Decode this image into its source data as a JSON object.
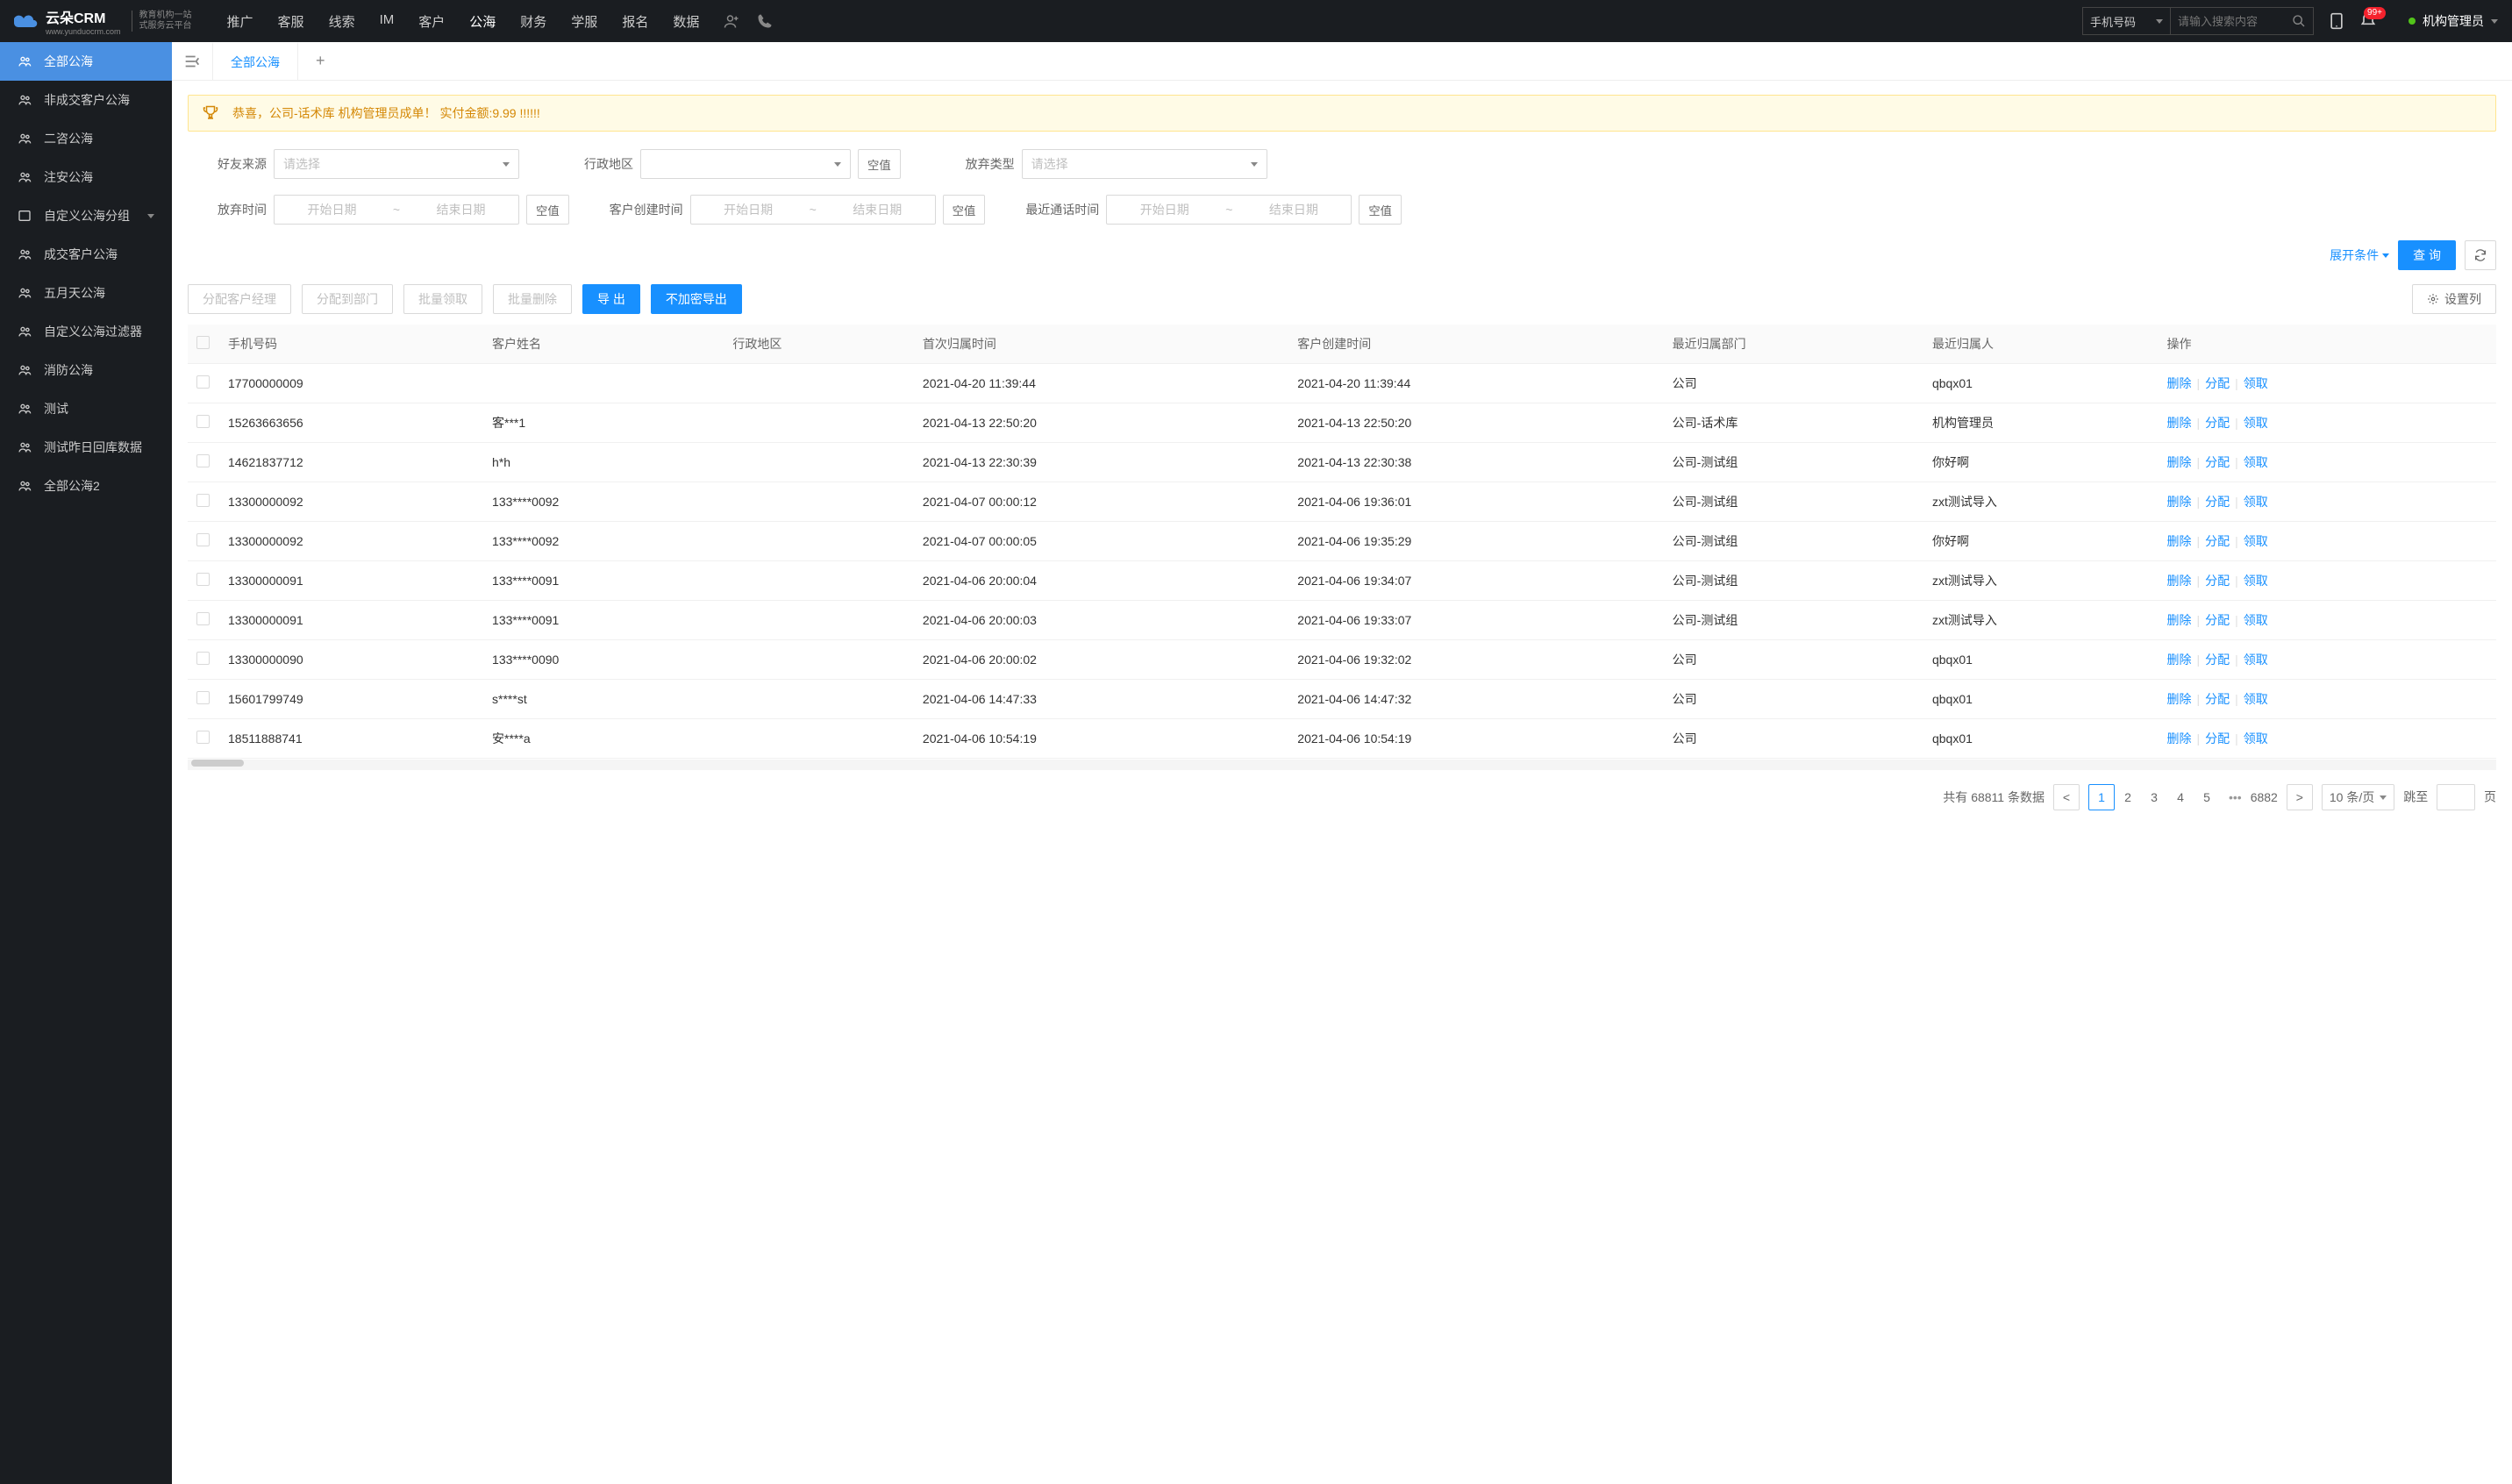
{
  "header": {
    "logo_text": "云朵CRM",
    "logo_sub1": "教育机构一站",
    "logo_sub2": "式服务云平台",
    "logo_domain": "www.yunduocrm.com",
    "nav": [
      "推广",
      "客服",
      "线索",
      "IM",
      "客户",
      "公海",
      "财务",
      "学服",
      "报名",
      "数据"
    ],
    "nav_active_index": 5,
    "search_type": "手机号码",
    "search_placeholder": "请输入搜索内容",
    "badge": "99+",
    "user": "机构管理员"
  },
  "sidebar": [
    {
      "label": "全部公海",
      "active": true,
      "icon": "user-team"
    },
    {
      "label": "非成交客户公海",
      "icon": "user-team"
    },
    {
      "label": "二咨公海",
      "icon": "user-team"
    },
    {
      "label": "注安公海",
      "icon": "user-team"
    },
    {
      "label": "自定义公海分组",
      "icon": "folder",
      "expandable": true
    },
    {
      "label": "成交客户公海",
      "icon": "user-team"
    },
    {
      "label": "五月天公海",
      "icon": "user-team"
    },
    {
      "label": "自定义公海过滤器",
      "icon": "user-team"
    },
    {
      "label": "消防公海",
      "icon": "user-team"
    },
    {
      "label": "测试",
      "icon": "user-team"
    },
    {
      "label": "测试昨日回库数据",
      "icon": "user-team"
    },
    {
      "label": "全部公海2",
      "icon": "user-team"
    }
  ],
  "tabs": {
    "active": "全部公海"
  },
  "banner": "恭喜，公司-话术库  机构管理员成单！  实付金额:9.99 !!!!!!",
  "filters": {
    "friend_source": {
      "label": "好友来源",
      "placeholder": "请选择"
    },
    "region": {
      "label": "行政地区",
      "placeholder": "",
      "empty": "空值"
    },
    "abandon_type": {
      "label": "放弃类型",
      "placeholder": "请选择"
    },
    "abandon_time": {
      "label": "放弃时间",
      "start": "开始日期",
      "end": "结束日期",
      "empty": "空值"
    },
    "create_time": {
      "label": "客户创建时间",
      "start": "开始日期",
      "end": "结束日期",
      "empty": "空值"
    },
    "call_time": {
      "label": "最近通话时间",
      "start": "开始日期",
      "end": "结束日期",
      "empty": "空值"
    },
    "expand": "展开条件",
    "query": "查 询"
  },
  "toolbar": {
    "assign_manager": "分配客户经理",
    "assign_dept": "分配到部门",
    "batch_claim": "批量领取",
    "batch_delete": "批量删除",
    "export": "导 出",
    "export_plain": "不加密导出",
    "set_columns": "设置列"
  },
  "table": {
    "columns": [
      "手机号码",
      "客户姓名",
      "行政地区",
      "首次归属时间",
      "客户创建时间",
      "最近归属部门",
      "最近归属人",
      "操作"
    ],
    "ops": {
      "delete": "删除",
      "assign": "分配",
      "claim": "领取"
    },
    "rows": [
      {
        "phone": "17700000009",
        "name": "",
        "region": "",
        "first_time": "2021-04-20 11:39:44",
        "create_time": "2021-04-20 11:39:44",
        "dept": "公司",
        "owner": "qbqx01"
      },
      {
        "phone": "15263663656",
        "name": "客***1",
        "region": "",
        "first_time": "2021-04-13 22:50:20",
        "create_time": "2021-04-13 22:50:20",
        "dept": "公司-话术库",
        "owner": "机构管理员"
      },
      {
        "phone": "14621837712",
        "name": "h*h",
        "region": "",
        "first_time": "2021-04-13 22:30:39",
        "create_time": "2021-04-13 22:30:38",
        "dept": "公司-测试组",
        "owner": "你好啊"
      },
      {
        "phone": "13300000092",
        "name": "133****0092",
        "region": "",
        "first_time": "2021-04-07 00:00:12",
        "create_time": "2021-04-06 19:36:01",
        "dept": "公司-测试组",
        "owner": "zxt测试导入"
      },
      {
        "phone": "13300000092",
        "name": "133****0092",
        "region": "",
        "first_time": "2021-04-07 00:00:05",
        "create_time": "2021-04-06 19:35:29",
        "dept": "公司-测试组",
        "owner": "你好啊"
      },
      {
        "phone": "13300000091",
        "name": "133****0091",
        "region": "",
        "first_time": "2021-04-06 20:00:04",
        "create_time": "2021-04-06 19:34:07",
        "dept": "公司-测试组",
        "owner": "zxt测试导入"
      },
      {
        "phone": "13300000091",
        "name": "133****0091",
        "region": "",
        "first_time": "2021-04-06 20:00:03",
        "create_time": "2021-04-06 19:33:07",
        "dept": "公司-测试组",
        "owner": "zxt测试导入"
      },
      {
        "phone": "13300000090",
        "name": "133****0090",
        "region": "",
        "first_time": "2021-04-06 20:00:02",
        "create_time": "2021-04-06 19:32:02",
        "dept": "公司",
        "owner": "qbqx01"
      },
      {
        "phone": "15601799749",
        "name": "s****st",
        "region": "",
        "first_time": "2021-04-06 14:47:33",
        "create_time": "2021-04-06 14:47:32",
        "dept": "公司",
        "owner": "qbqx01"
      },
      {
        "phone": "18511888741",
        "name": "安****a",
        "region": "",
        "first_time": "2021-04-06 10:54:19",
        "create_time": "2021-04-06 10:54:19",
        "dept": "公司",
        "owner": "qbqx01"
      }
    ]
  },
  "pagination": {
    "total_prefix": "共有",
    "total": "68811",
    "total_suffix": "条数据",
    "pages": [
      "1",
      "2",
      "3",
      "4",
      "5"
    ],
    "last": "6882",
    "per_page": "10 条/页",
    "jump_label": "跳至",
    "jump_suffix": "页"
  }
}
